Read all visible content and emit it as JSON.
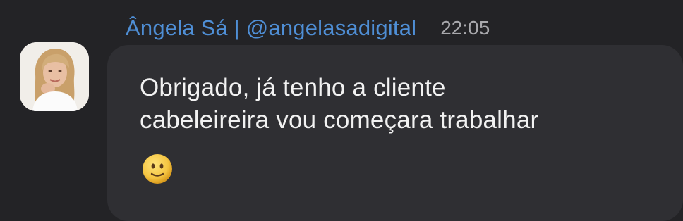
{
  "message": {
    "sender": "Ângela Sá | @angelasadigital",
    "time": "22:05",
    "text_lines": [
      "Obrigado, já tenho a cliente",
      "cabeleireira vou começara trabalhar"
    ],
    "emoji": "slightly-smiling-face"
  },
  "colors": {
    "background": "#232326",
    "bubble": "#2f2f33",
    "sender": "#4f8fd6",
    "timestamp": "#a9a9ad",
    "text": "#f2f2f2"
  }
}
